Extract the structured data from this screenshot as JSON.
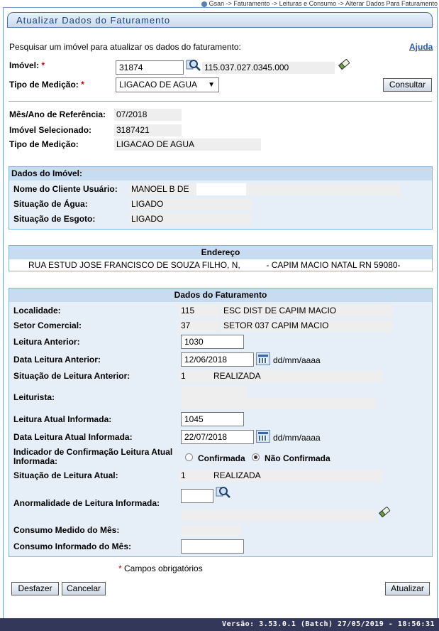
{
  "breadcrumb": "Gsan -> Faturamento -> Leituras e Consumo -> Alterar Dados Para Faturamento",
  "page_title": "Atualizar Dados do Faturamento",
  "help_link": "Ajuda",
  "search": {
    "instruction": "Pesquisar um imóvel para atualizar os dados do faturamento:",
    "imovel_label": "Imóvel:",
    "imovel_value": "31874",
    "imovel_inscricao": "115.037.027.0345.000",
    "tipo_medicao_label": "Tipo de Medição:",
    "tipo_medicao_value": "LIGACAO DE AGUA",
    "required_mark": "*",
    "consultar_button": "Consultar"
  },
  "summary": {
    "mes_ano_label": "Mês/Ano de Referência:",
    "mes_ano_value": "07/2018",
    "imovel_sel_label": "Imóvel Selecionado:",
    "imovel_sel_value": "3187421",
    "tipo_medicao_label": "Tipo de Medição:",
    "tipo_medicao_value": "LIGACAO DE AGUA"
  },
  "dados_imovel": {
    "header": "Dados do Imóvel:",
    "cliente_label": "Nome do Cliente Usuário:",
    "cliente_value": "MANOEL B DE",
    "agua_label": "Situação de Água:",
    "agua_value": "LIGADO",
    "esgoto_label": "Situação de Esgoto:",
    "esgoto_value": "LIGADO"
  },
  "endereco": {
    "header": "Endereço",
    "value": "RUA ESTUD JOSE FRANCISCO DE SOUZA FILHO, N,           - CAPIM MACIO NATAL RN 59080-"
  },
  "faturamento": {
    "header": "Dados do Faturamento",
    "localidade_label": "Localidade:",
    "localidade_code": "115",
    "localidade_name": "ESC DIST DE CAPIM MACIO",
    "setor_label": "Setor Comercial:",
    "setor_code": "37",
    "setor_name": "SETOR 037 CAPIM MACIO",
    "leitura_ant_label": "Leitura Anterior:",
    "leitura_ant_value": "1030",
    "data_leitura_ant_label": "Data Leitura Anterior:",
    "data_leitura_ant_value": "12/06/2018",
    "date_format": "dd/mm/aaaa",
    "sit_leitura_ant_label": "Situação de Leitura Anterior:",
    "sit_leitura_ant_code": "1",
    "sit_leitura_ant_name": "REALIZADA",
    "leiturista_label": "Leiturista:",
    "leitura_atual_label": "Leitura Atual Informada:",
    "leitura_atual_value": "1045",
    "data_leitura_atual_label": "Data Leitura Atual Informada:",
    "data_leitura_atual_value": "22/07/2018",
    "indicador_label_1": "Indicador de Confirmação Leitura Atual",
    "indicador_label_2": "Informada:",
    "confirmada_label": "Confirmada",
    "nao_confirmada_label": "Não Confirmada",
    "sit_leitura_atual_label": "Situação de Leitura Atual:",
    "sit_leitura_atual_code": "1",
    "sit_leitura_atual_name": "REALIZADA",
    "anormalidade_label": "Anormalidade de Leitura Informada:",
    "consumo_medido_label": "Consumo Medido do Mês:",
    "consumo_informado_label": "Consumo Informado do Mês:"
  },
  "required_note": "Campos obrigatórios",
  "buttons": {
    "desfazer": "Desfazer",
    "cancelar": "Cancelar",
    "atualizar": "Atualizar"
  },
  "version": "Versão: 3.53.0.1 (Batch) 27/05/2019 - 18:56:31"
}
